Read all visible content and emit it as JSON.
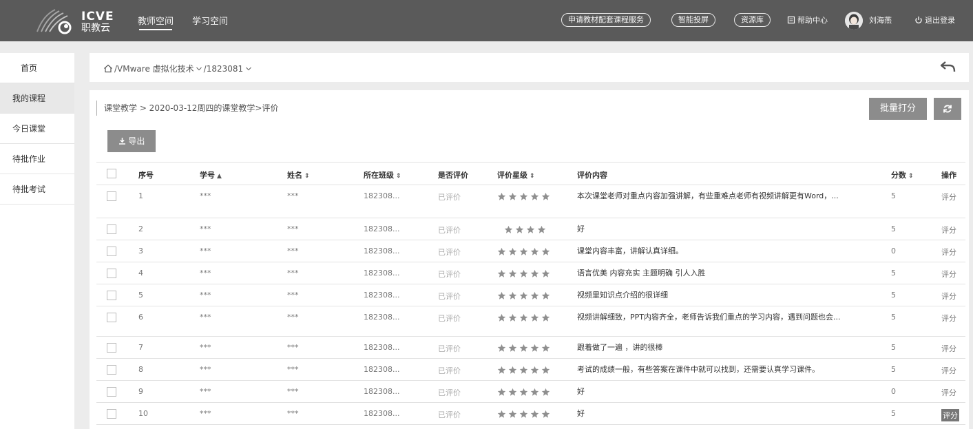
{
  "header": {
    "logo_en": "ICVE",
    "logo_cn": "职教云",
    "tabs": [
      {
        "label": "教师空间",
        "active": true
      },
      {
        "label": "学习空间",
        "active": false
      }
    ],
    "pills": [
      "申请教材配套课程服务",
      "智能投屏",
      "资源库"
    ],
    "help": "帮助中心",
    "user": "刘海燕",
    "logout": "退出登录"
  },
  "sidebar": {
    "items": [
      {
        "label": "首页",
        "active": false
      },
      {
        "label": "我的课程",
        "active": true
      },
      {
        "label": "今日课堂",
        "active": false
      },
      {
        "label": "待批作业",
        "active": false
      },
      {
        "label": "待批考试",
        "active": false
      }
    ]
  },
  "breadcrumb": {
    "course": "/VMware 虚拟化技术",
    "class": "/1823081"
  },
  "main": {
    "subcrumb": "课堂教学  > 2020-03-12周四的课堂教学>评价",
    "batch_label": "批量打分",
    "export_label": "导出"
  },
  "table": {
    "headers": {
      "seq": "序号",
      "sid": "学号",
      "name": "姓名",
      "class": "所在班级",
      "evaluated": "是否评价",
      "stars": "评价星级",
      "content": "评价内容",
      "score": "分数",
      "op": "操作"
    },
    "rows": [
      {
        "seq": "1",
        "sid": "***",
        "name": "***",
        "class": "182308...",
        "evaluated": "已评价",
        "stars": 5,
        "content": "本次课堂老师对重点内容加强讲解，有些重难点老师有视频讲解更有Word，...",
        "score": "5",
        "op": "评分"
      },
      {
        "seq": "2",
        "sid": "***",
        "name": "***",
        "class": "182308...",
        "evaluated": "已评价",
        "stars": 4,
        "content": "好",
        "score": "5",
        "op": "评分"
      },
      {
        "seq": "3",
        "sid": "***",
        "name": "***",
        "class": "182308...",
        "evaluated": "已评价",
        "stars": 5,
        "content": "课堂内容丰富，讲解认真详细。",
        "score": "0",
        "op": "评分"
      },
      {
        "seq": "4",
        "sid": "***",
        "name": "***",
        "class": "182308...",
        "evaluated": "已评价",
        "stars": 5,
        "content": "语言优美 内容充实 主题明确 引人入胜",
        "score": "5",
        "op": "评分"
      },
      {
        "seq": "5",
        "sid": "***",
        "name": "***",
        "class": "182308...",
        "evaluated": "已评价",
        "stars": 5,
        "content": "视频里知识点介绍的很详细",
        "score": "5",
        "op": "评分"
      },
      {
        "seq": "6",
        "sid": "***",
        "name": "***",
        "class": "182308...",
        "evaluated": "已评价",
        "stars": 5,
        "content": "视频讲解细致，PPT内容齐全，老师告诉我们重点的学习内容，遇到问题也会...",
        "score": "5",
        "op": "评分"
      },
      {
        "seq": "7",
        "sid": "***",
        "name": "***",
        "class": "182308...",
        "evaluated": "已评价",
        "stars": 5,
        "content": "跟着做了一遍 ，讲的很棒",
        "score": "5",
        "op": "评分"
      },
      {
        "seq": "8",
        "sid": "***",
        "name": "***",
        "class": "182308...",
        "evaluated": "已评价",
        "stars": 5,
        "content": "考试的成绩一般，有些答案在课件中就可以找到，还需要认真学习课件。",
        "score": "5",
        "op": "评分"
      },
      {
        "seq": "9",
        "sid": "***",
        "name": "***",
        "class": "182308...",
        "evaluated": "已评价",
        "stars": 5,
        "content": "好",
        "score": "0",
        "op": "评分"
      },
      {
        "seq": "10",
        "sid": "***",
        "name": "***",
        "class": "182308...",
        "evaluated": "已评价",
        "stars": 5,
        "content": "好",
        "score": "5",
        "op": "评分"
      }
    ]
  },
  "colors": {
    "header_bg": "#5a5a5a",
    "button_bg": "#8c8c8c",
    "star": "#8f8f8f"
  }
}
